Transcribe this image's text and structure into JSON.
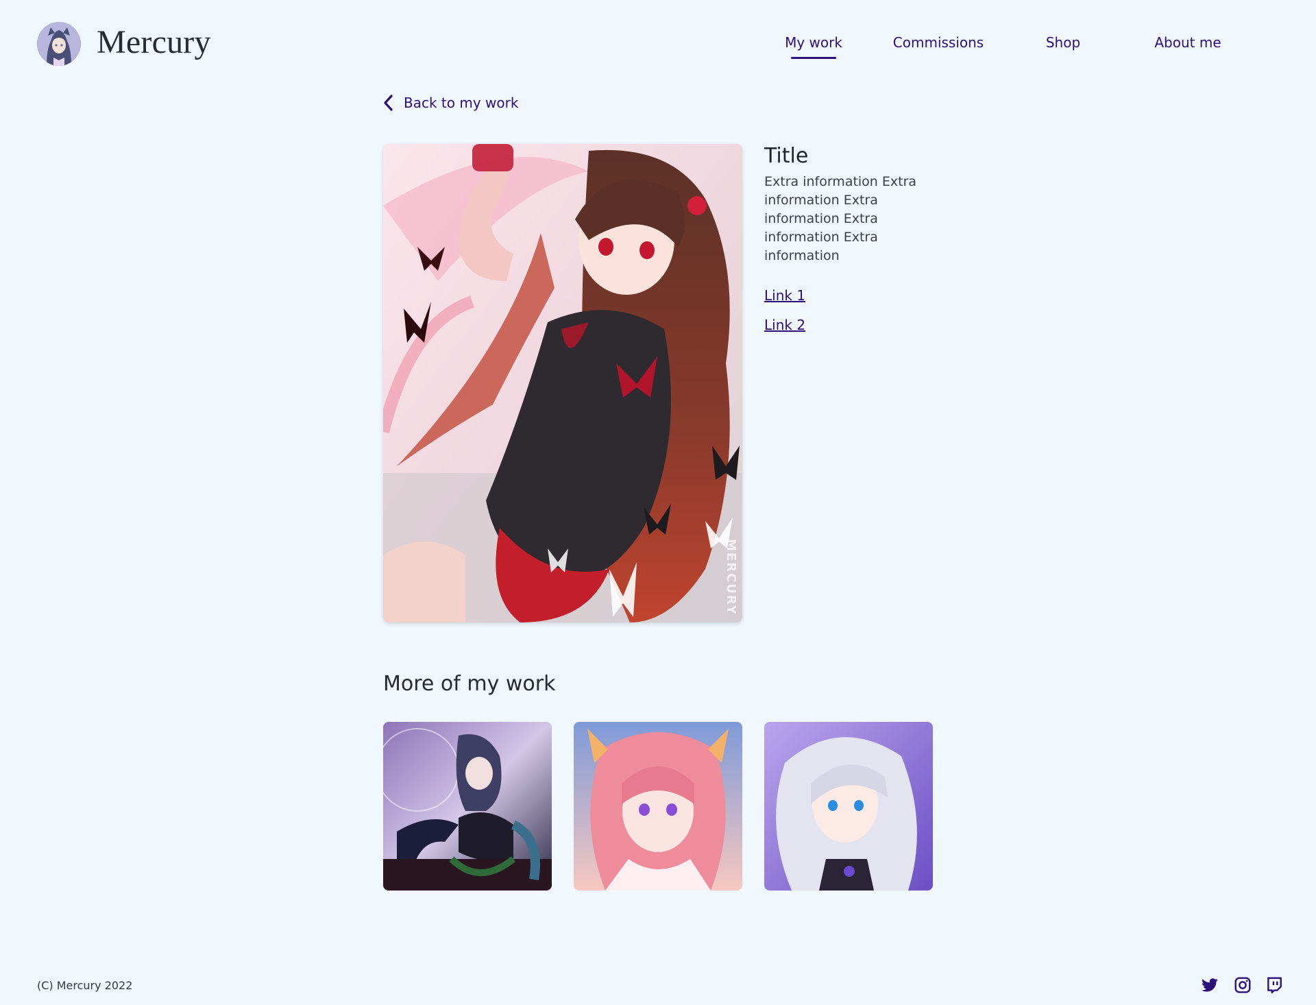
{
  "brand": {
    "name": "Mercury",
    "avatar_icon": "character-avatar-icon"
  },
  "nav": {
    "items": [
      {
        "label": "My work",
        "active": true
      },
      {
        "label": "Commissions",
        "active": false
      },
      {
        "label": "Shop",
        "active": false
      },
      {
        "label": "About me",
        "active": false
      }
    ],
    "accent_color": "#2c0f78"
  },
  "back_link": {
    "label": "Back to my work",
    "icon": "chevron-left-icon"
  },
  "artwork": {
    "title": "Title",
    "description": "Extra information Extra information Extra information Extra information Extra information",
    "links": [
      {
        "label": "Link 1"
      },
      {
        "label": "Link 2"
      }
    ],
    "watermark": "MERCURY"
  },
  "more": {
    "heading": "More of my work",
    "thumbnails": [
      {
        "icon": "artwork-thumbnail-dark-haired-girl"
      },
      {
        "icon": "artwork-thumbnail-pink-haired-girl"
      },
      {
        "icon": "artwork-thumbnail-silver-haired-girl"
      }
    ]
  },
  "footer": {
    "copyright": "(C) Mercury 2022",
    "social": [
      {
        "icon": "twitter-icon"
      },
      {
        "icon": "instagram-icon"
      },
      {
        "icon": "twitch-icon"
      }
    ]
  },
  "colors": {
    "background": "#f0f8fe",
    "accent": "#2c0f78",
    "text": "#262a33"
  }
}
